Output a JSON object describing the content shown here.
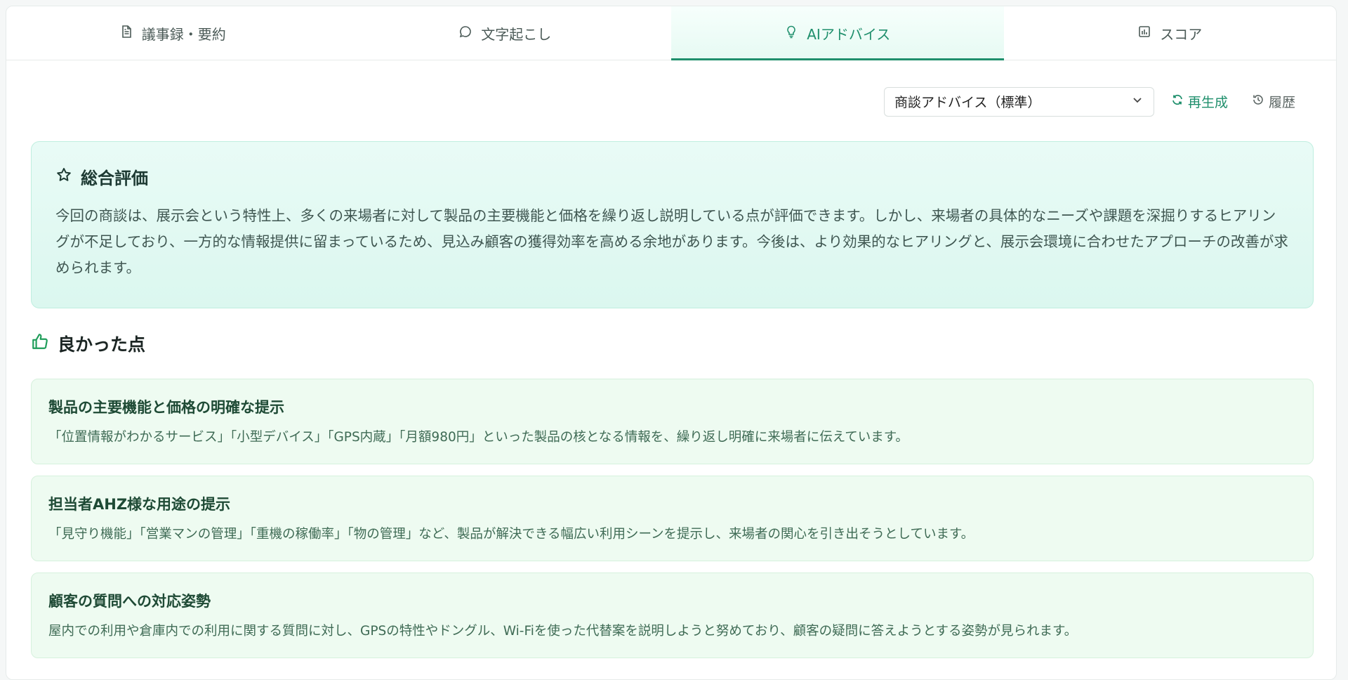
{
  "tabs": [
    {
      "label": "議事録・要約",
      "icon": "document-icon"
    },
    {
      "label": "文字起こし",
      "icon": "chat-bubble-icon"
    },
    {
      "label": "AIアドバイス",
      "icon": "lightbulb-icon",
      "active": true
    },
    {
      "label": "スコア",
      "icon": "bar-chart-icon"
    }
  ],
  "toolbar": {
    "select_value": "商談アドバイス（標準）",
    "regenerate_label": "再生成",
    "history_label": "履歴"
  },
  "summary": {
    "title": "総合評価",
    "text": "今回の商談は、展示会という特性上、多くの来場者に対して製品の主要機能と価格を繰り返し説明している点が評価できます。しかし、来場者の具体的なニーズや課題を深掘りするヒアリングが不足しており、一方的な情報提供に留まっているため、見込み顧客の獲得効率を高める余地があります。今後は、より効果的なヒアリングと、展示会環境に合わせたアプローチの改善が求められます。"
  },
  "good_points": {
    "title": "良かった点",
    "items": [
      {
        "title": "製品の主要機能と価格の明確な提示",
        "text": "「位置情報がわかるサービス」「小型デバイス」「GPS内蔵」「月額980円」といった製品の核となる情報を、繰り返し明確に来場者に伝えています。"
      },
      {
        "title": "担当者AHZ様な用途の提示",
        "text": "「見守り機能」「営業マンの管理」「重機の稼働率」「物の管理」など、製品が解決できる幅広い利用シーンを提示し、来場者の関心を引き出そうとしています。"
      },
      {
        "title": "顧客の質問への対応姿勢",
        "text": "屋内での利用や倉庫内での利用に関する質問に対し、GPSの特性やドングル、Wi-Fiを使った代替案を説明しようと努めており、顧客の疑問に答えようとする姿勢が見られます。"
      }
    ]
  },
  "colors": {
    "accent": "#1f8f6c",
    "summary_bg": "#dbf7ef",
    "point_bg": "#eefbf1"
  }
}
